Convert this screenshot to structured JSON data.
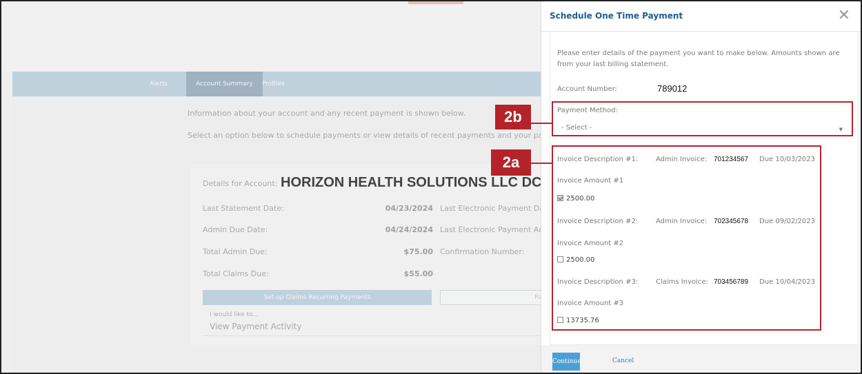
{
  "background": {
    "nav": [
      "Alerts",
      "Account Summary",
      "Profiles"
    ],
    "info_line": "Information about your account and any recent payment is shown below.",
    "select_line": "Select an option below to schedule payments or view details of recent payments and your payment m",
    "details_label": "Details for Account:",
    "account_name": "HORIZON HEALTH SOLUTIONS LLC DCA |",
    "rows": [
      {
        "label": "Last Statement Date:",
        "value": "04/23/2024",
        "right": "Last Electronic Payment Dat"
      },
      {
        "label": "Admin Due Date:",
        "value": "04/24/2024",
        "right": "Last Electronic Payment Am"
      },
      {
        "label": "Total Admin Due:",
        "value": "$75.00",
        "right": "Confirmation Number:"
      },
      {
        "label": "Total Claims Due:",
        "value": "$55.00",
        "right": ""
      }
    ],
    "btn_recurring": "Set up Claims Recurring Payments",
    "btn_pay": "Pay",
    "select_small": "I would like to...",
    "select_value": "View Payment Activity"
  },
  "modal": {
    "title": "Schedule One Time Payment",
    "close_icon": "close-icon",
    "intro": "Please enter details of the payment you want to make below. Amounts shown are from your last billing statement.",
    "account_label": "Account Number:",
    "account_number": "789012",
    "method_label": "Payment Method:",
    "method_value": "- Select -",
    "invoices": [
      {
        "desc_label": "Invoice Description #1:",
        "type": "Admin Invoice:",
        "number": "701234567",
        "due": "Due 10/03/2023",
        "amount_label": "Invoice Amount #1",
        "amount": "2500.00",
        "checked": true
      },
      {
        "desc_label": "Invoice Description #2:",
        "type": "Admin Invoice:",
        "number": "702345678",
        "due": "Due 09/02/2023",
        "amount_label": "Invoice Amount #2",
        "amount": "2500.00",
        "checked": false
      },
      {
        "desc_label": "Invoice Description #3:",
        "type": "Claims Invoice:",
        "number": "703456789",
        "due": "Due 10/04/2023",
        "amount_label": "Invoice Amount #3",
        "amount": "13735.76",
        "checked": false
      }
    ],
    "continue_label": "Continue",
    "cancel_label": "Cancel"
  },
  "callouts": {
    "a": "2a",
    "b": "2b",
    "color": "#b5232a"
  }
}
